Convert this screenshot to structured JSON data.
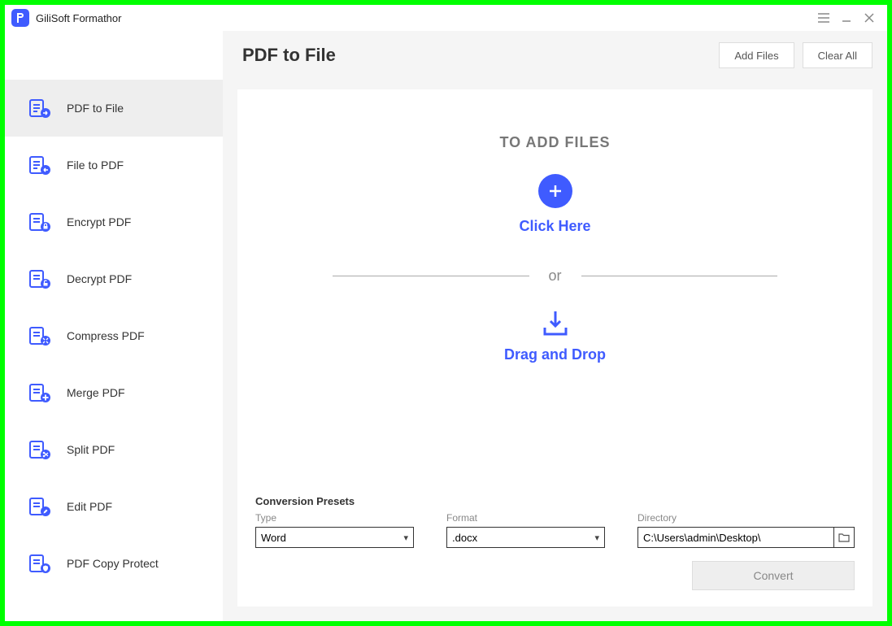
{
  "app": {
    "title": "GiliSoft Formathor"
  },
  "sidebar": {
    "items": [
      {
        "label": "PDF to File",
        "icon": "pdf-to-file",
        "active": true
      },
      {
        "label": "File to PDF",
        "icon": "file-to-pdf",
        "active": false
      },
      {
        "label": "Encrypt PDF",
        "icon": "encrypt",
        "active": false
      },
      {
        "label": "Decrypt PDF",
        "icon": "decrypt",
        "active": false
      },
      {
        "label": "Compress PDF",
        "icon": "compress",
        "active": false
      },
      {
        "label": "Merge PDF",
        "icon": "merge",
        "active": false
      },
      {
        "label": "Split PDF",
        "icon": "split",
        "active": false
      },
      {
        "label": "Edit PDF",
        "icon": "edit",
        "active": false
      },
      {
        "label": "PDF Copy Protect",
        "icon": "protect",
        "active": false
      }
    ]
  },
  "header": {
    "title": "PDF to File",
    "add_files": "Add Files",
    "clear_all": "Clear All"
  },
  "dropzone": {
    "title": "TO ADD FILES",
    "click_here": "Click Here",
    "or": "or",
    "drag_drop": "Drag and Drop"
  },
  "presets": {
    "title": "Conversion Presets",
    "type_label": "Type",
    "type_value": "Word",
    "format_label": "Format",
    "format_value": ".docx",
    "directory_label": "Directory",
    "directory_value": "C:\\Users\\admin\\Desktop\\",
    "convert": "Convert"
  }
}
